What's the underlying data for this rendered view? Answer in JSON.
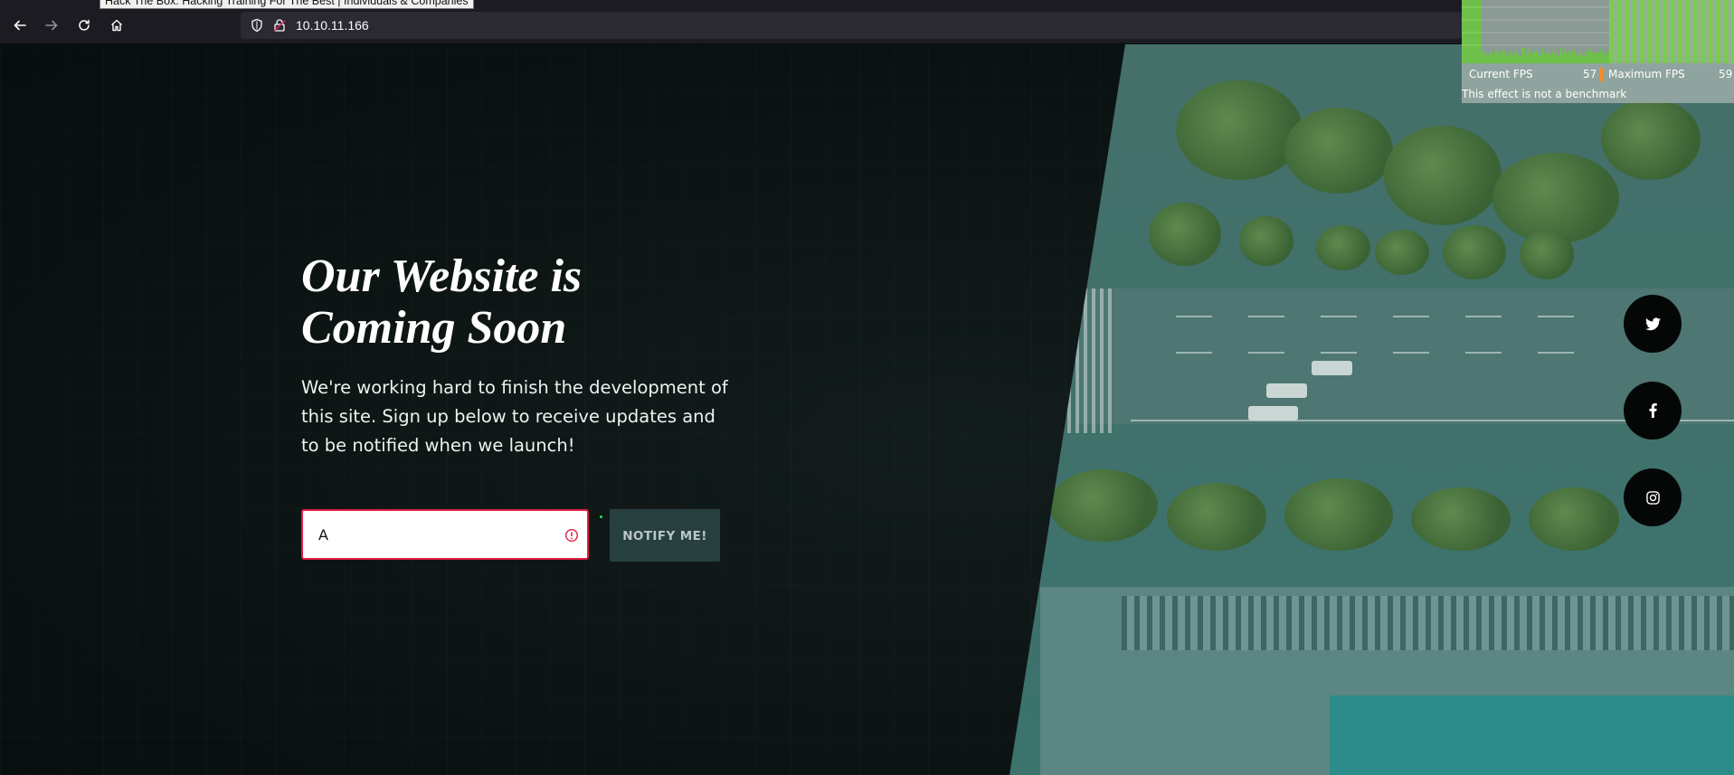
{
  "browser": {
    "tab_tooltip": "Hack The Box: Hacking Training For The Best | Individuals & Companies",
    "url": "10.10.11.166",
    "icons": [
      "back-arrow-icon",
      "forward-arrow-icon",
      "reload-icon",
      "home-icon",
      "shield-icon",
      "lock-icon",
      "star-icon",
      "pocket-icon",
      "download-icon",
      "menu-icon"
    ]
  },
  "fps_overlay": {
    "current_label": "Current FPS",
    "current_value": "57",
    "max_label": "Maximum FPS",
    "max_value": "59",
    "note": "This effect is not a benchmark"
  },
  "hero": {
    "title_line1": "Our Website is",
    "title_line2": "Coming Soon",
    "text": "We're working hard to finish the development of this site. Sign up below to receive updates and to be notified when we launch!"
  },
  "signup": {
    "email_value": "A",
    "notify_label": "NOTIFY ME!",
    "error_color": "#e01d43",
    "button_color": "#27403f"
  },
  "social": {
    "icons": [
      "twitter-icon",
      "facebook-icon",
      "instagram-icon"
    ]
  }
}
